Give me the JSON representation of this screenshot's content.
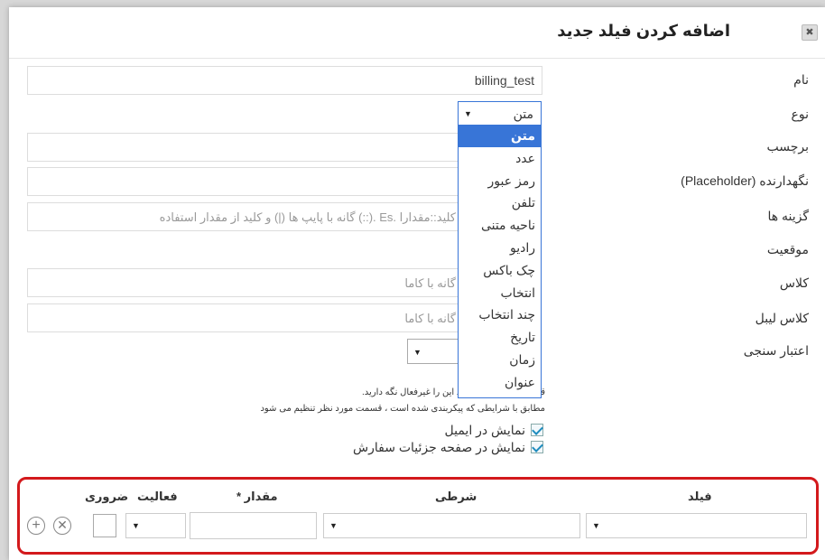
{
  "modal": {
    "title": "اضافه کردن فیلد جدید",
    "close_icon": "close-icon"
  },
  "form": {
    "name": {
      "label": "نام",
      "value": "billing_test"
    },
    "type": {
      "label": "نوع",
      "value": "متن"
    },
    "label_field": {
      "label": "برچسب"
    },
    "placeholder_field": {
      "label": "نگهدارنده (Placeholder)"
    },
    "options": {
      "label": "گزینه ها",
      "placeholder": "گانه با پایپ ها (|) و کلید از مقدار استفاده (::). Es. کلید::مقدارا"
    },
    "position": {
      "label": "موقعیت"
    },
    "class": {
      "label": "کلاس",
      "placeholder": "گانه با کاما"
    },
    "label_class": {
      "label": "کلاس لیبل",
      "placeholder": "گانه با کاما"
    },
    "validation": {
      "label": "اعتبار سنجی"
    }
  },
  "type_dropdown": {
    "options": [
      "متن",
      "عدد",
      "رمز عبور",
      "تلفن",
      "ناحیه متنی",
      "رادیو",
      "چک باکس",
      "انتخاب",
      "چند انتخاب",
      "تاریخ",
      "زمان",
      "عنوان"
    ],
    "selected_index": 0
  },
  "notes": {
    "line1": "قل یک شرط تنظیم کنید این را غیرفعال نگه دارید.",
    "line2": "مطابق با شرایطی که پیکربندی شده است ، قسمت مورد نظر تنظیم می شود"
  },
  "checkboxes": {
    "show_in_email": {
      "label": "نمایش در ایمیل",
      "checked": true
    },
    "show_in_order": {
      "label": "نمایش در صفحه جزئیات سفارش",
      "checked": true
    }
  },
  "conditions": {
    "headers": {
      "field": "فیلد",
      "conditional": "شرطی",
      "value": "مقدار *",
      "activity": "فعالیت",
      "required": "ضروری"
    },
    "highlight_color": "#d3191c"
  },
  "colors": {
    "dropdown_active": "#3875d7",
    "checkbox_check": "#1e8cbe"
  }
}
